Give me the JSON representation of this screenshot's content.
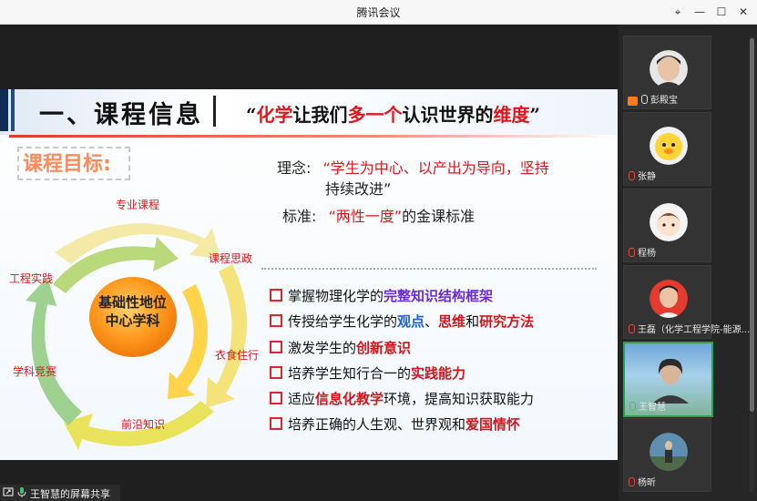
{
  "window": {
    "title": "腾讯会议",
    "minimize": "—",
    "maximize": "☐",
    "close": "✕",
    "pin": "⌖"
  },
  "slide": {
    "heading": "一、课程信息",
    "motto": {
      "open": "“",
      "p1": "化学",
      "p2": "让我们",
      "p3": "多一个",
      "p4": "认识世界的",
      "p5": "维度",
      "close": "”"
    },
    "goal_label": "课程目标:",
    "concept_label": "理念:",
    "concept_line1": "“学生为中心、以产出为导向，坚持",
    "concept_line2": "持续改进”",
    "standard_label": "标准:",
    "standard_value": "“两性一度”",
    "standard_suffix": "的金课标准",
    "bullets": [
      {
        "a": "掌握物理化学的",
        "b": "完整知识结构框架",
        "c": ""
      },
      {
        "a": "传授给学生化学的",
        "b": "观点",
        "c": "、",
        "d": "思维",
        "e": "和",
        "f": "研究方法"
      },
      {
        "a": "激发学生的",
        "b": "创新意识",
        "c": ""
      },
      {
        "a": "培养学生知行合一的",
        "b": "实践能力",
        "c": ""
      },
      {
        "a": "适应",
        "b": "信息化教学",
        "c": "环境，提高知识获取能力"
      },
      {
        "a": "培养正确的人生观、世界观和",
        "b": "爱国情怀",
        "c": ""
      }
    ],
    "diagram": {
      "center_line1": "基础性地位",
      "center_line2": "中心学科",
      "labels": [
        "专业课程",
        "课程思政",
        "衣食住行",
        "前沿知识",
        "学科竞赛",
        "工程实践"
      ]
    }
  },
  "share_label": "王智慧的屏幕共享",
  "participants": [
    {
      "name": "彭殿宝",
      "host": true
    },
    {
      "name": "张静"
    },
    {
      "name": "程杨"
    },
    {
      "name": "王磊（化学工程学院-能源..."
    },
    {
      "name": "王智慧",
      "active": true
    },
    {
      "name": "杨昕"
    }
  ],
  "colors": {
    "accent_red": "#e0161d",
    "navy": "#0d2c57",
    "speaking_green": "#2f9e55"
  }
}
